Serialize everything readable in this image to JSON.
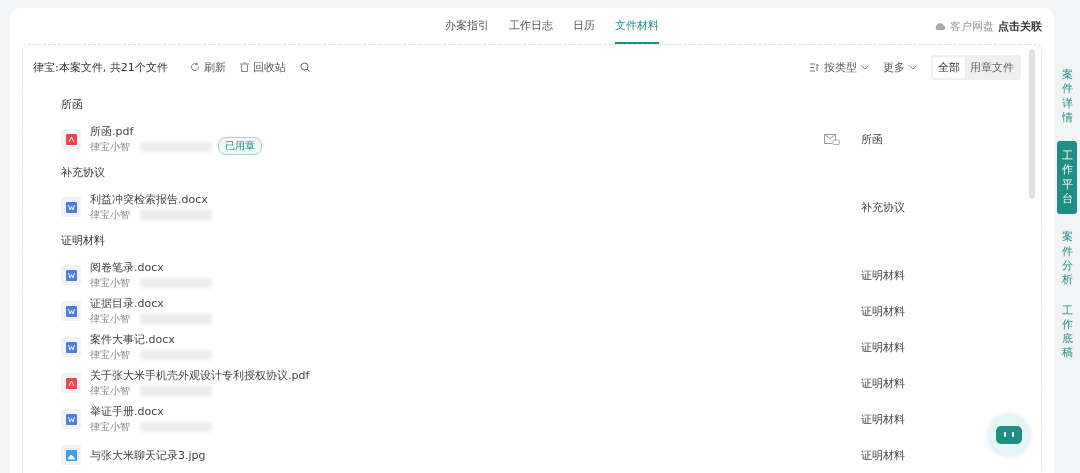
{
  "nav_tabs": [
    {
      "label": "办案指引",
      "selected": false
    },
    {
      "label": "工作日志",
      "selected": false
    },
    {
      "label": "日历",
      "selected": false
    },
    {
      "label": "文件材料",
      "selected": true
    }
  ],
  "cloud": {
    "label": "客户网盘",
    "action": "点击关联"
  },
  "toolbar": {
    "summary": "律宝:本案文件, 共21个文件",
    "refresh": "刷新",
    "recycle": "回收站",
    "sort": "按类型",
    "more": "更多",
    "filters": [
      {
        "label": "全部",
        "selected": true
      },
      {
        "label": "用章文件",
        "selected": false
      }
    ]
  },
  "groups": [
    {
      "title": "所函",
      "files": [
        {
          "name": "所函.pdf",
          "kind": "pdf",
          "sender": "律宝小智",
          "badge": "已用章",
          "mailed": true,
          "category": "所函"
        }
      ]
    },
    {
      "title": "补充协议",
      "files": [
        {
          "name": "利益冲突检索报告.docx",
          "kind": "docx",
          "sender": "律宝小智",
          "mailed": false,
          "category": "补充协议"
        }
      ]
    },
    {
      "title": "证明材料",
      "files": [
        {
          "name": "阅卷笔录.docx",
          "kind": "docx",
          "sender": "律宝小智",
          "mailed": false,
          "category": "证明材料"
        },
        {
          "name": "证据目录.docx",
          "kind": "docx",
          "sender": "律宝小智",
          "mailed": false,
          "category": "证明材料"
        },
        {
          "name": "案件大事记.docx",
          "kind": "docx",
          "sender": "律宝小智",
          "mailed": false,
          "category": "证明材料"
        },
        {
          "name": "关于张大米手机壳外观设计专利授权协议.pdf",
          "kind": "pdf",
          "sender": "律宝小智",
          "mailed": false,
          "category": "证明材料"
        },
        {
          "name": "举证手册.docx",
          "kind": "docx",
          "sender": "律宝小智",
          "mailed": false,
          "category": "证明材料"
        },
        {
          "name": "与张大米聊天记录3.jpg",
          "kind": "jpg",
          "mailed": false,
          "category": "证明材料"
        }
      ]
    }
  ],
  "side_tabs": [
    {
      "label": "案件详情",
      "selected": false
    },
    {
      "label": "工作平台",
      "selected": true
    },
    {
      "label": "案件分析",
      "selected": false
    },
    {
      "label": "工作底稿",
      "selected": false
    }
  ]
}
